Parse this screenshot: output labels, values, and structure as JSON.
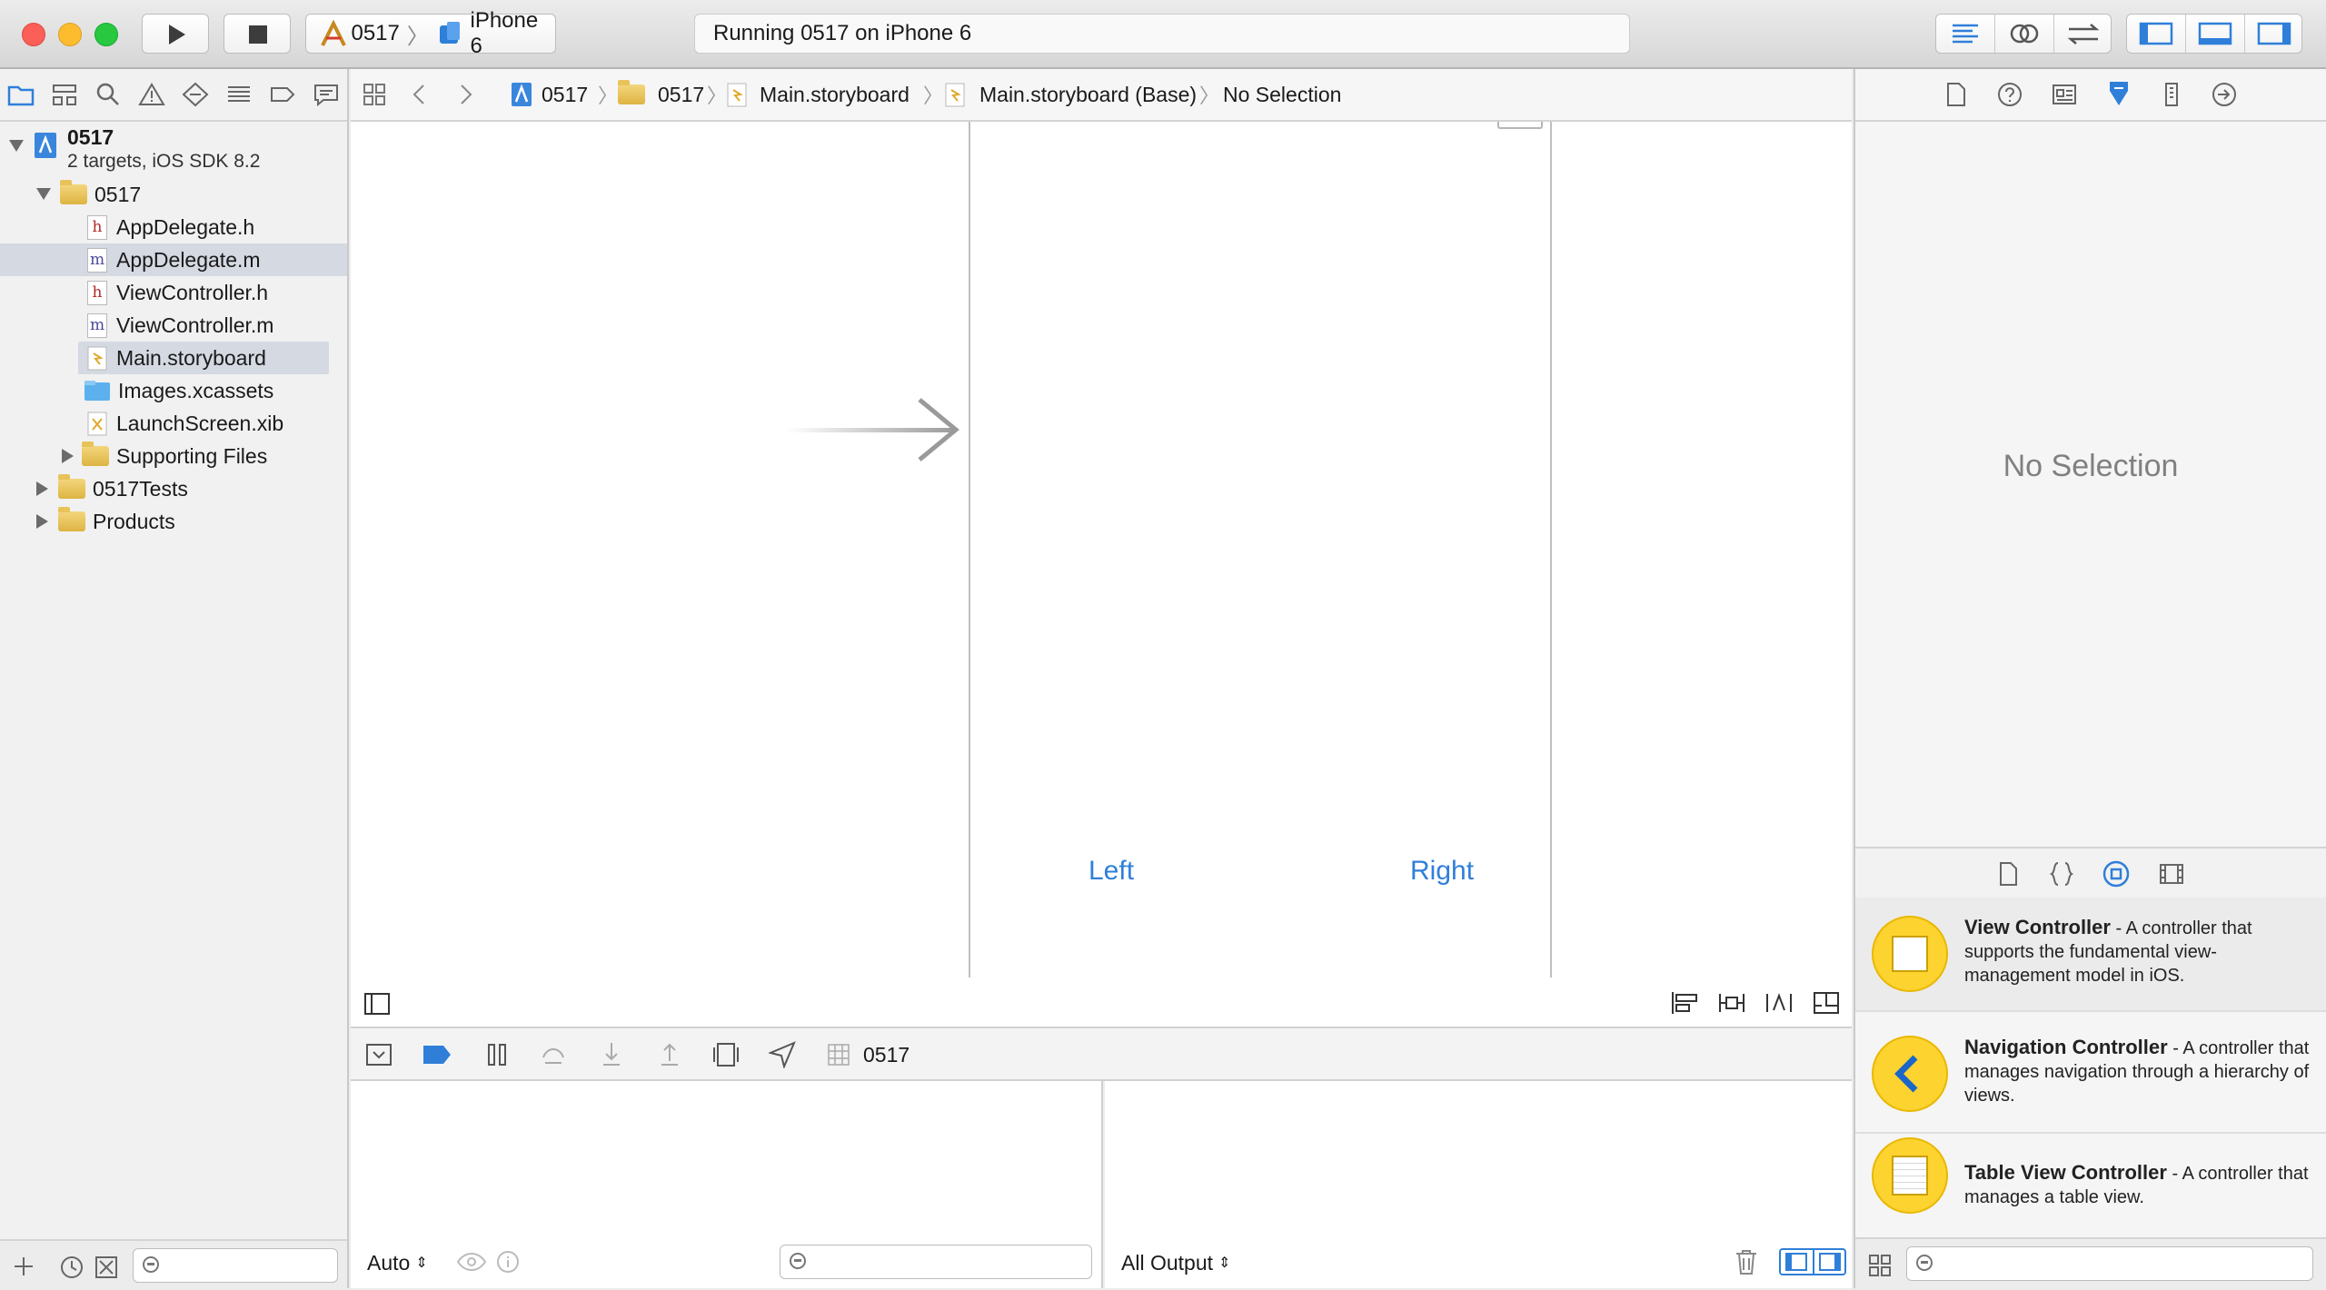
{
  "toolbar": {
    "scheme_target": "0517",
    "scheme_device": "iPhone 6",
    "activity_status": "Running 0517 on iPhone 6"
  },
  "navigator": {
    "project": {
      "name": "0517",
      "subtitle": "2 targets, iOS SDK 8.2"
    },
    "items": [
      {
        "label": "0517",
        "kind": "folder"
      },
      {
        "label": "AppDelegate.h",
        "kind": "header",
        "badge": "h"
      },
      {
        "label": "AppDelegate.m",
        "kind": "impl",
        "badge": "m"
      },
      {
        "label": "ViewController.h",
        "kind": "header",
        "badge": "h"
      },
      {
        "label": "ViewController.m",
        "kind": "impl",
        "badge": "m"
      },
      {
        "label": "Main.storyboard",
        "kind": "storyboard"
      },
      {
        "label": "Images.xcassets",
        "kind": "assets"
      },
      {
        "label": "LaunchScreen.xib",
        "kind": "xib"
      },
      {
        "label": "Supporting Files",
        "kind": "folder"
      },
      {
        "label": "0517Tests",
        "kind": "folder"
      },
      {
        "label": "Products",
        "kind": "folder"
      }
    ]
  },
  "jumpbar": {
    "crumbs": [
      "0517",
      "0517",
      "Main.storyboard",
      "Main.storyboard (Base)",
      "No Selection"
    ]
  },
  "canvas": {
    "left_button": "Left",
    "right_button": "Right"
  },
  "debug": {
    "process": "0517",
    "variables_scope": "Auto",
    "console_scope": "All Output"
  },
  "inspector": {
    "empty_message": "No Selection"
  },
  "library": {
    "items": [
      {
        "title": "View Controller",
        "description": " - A controller that supports the fundamental view-management model in iOS."
      },
      {
        "title": "Navigation Controller",
        "description": " - A controller that manages navigation through a hierarchy of views."
      },
      {
        "title": "Table View Controller",
        "description": " - A controller that manages a table view."
      }
    ]
  },
  "colors": {
    "accent": "#2f7fd9",
    "selection": "#d4d9e2",
    "library_icon": "#fdd330"
  }
}
